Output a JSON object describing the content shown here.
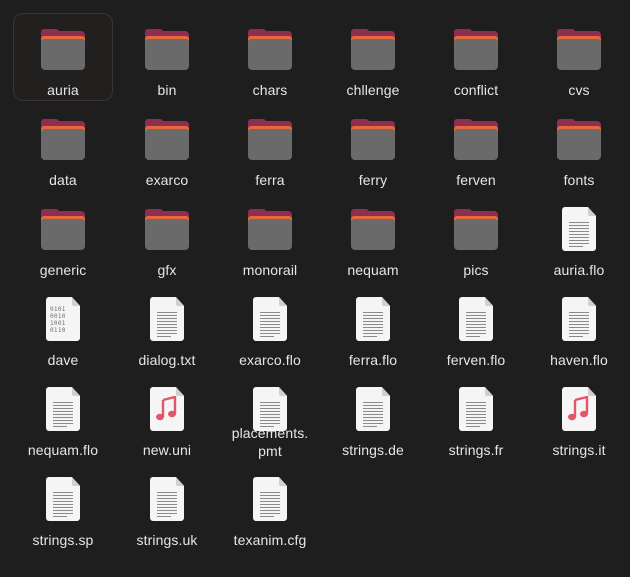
{
  "files": [
    {
      "name": "auria",
      "type": "folder",
      "selected": true
    },
    {
      "name": "bin",
      "type": "folder"
    },
    {
      "name": "chars",
      "type": "folder"
    },
    {
      "name": "chllenge",
      "type": "folder"
    },
    {
      "name": "conflict",
      "type": "folder"
    },
    {
      "name": "cvs",
      "type": "folder"
    },
    {
      "name": "data",
      "type": "folder"
    },
    {
      "name": "exarco",
      "type": "folder"
    },
    {
      "name": "ferra",
      "type": "folder"
    },
    {
      "name": "ferry",
      "type": "folder"
    },
    {
      "name": "ferven",
      "type": "folder"
    },
    {
      "name": "fonts",
      "type": "folder"
    },
    {
      "name": "generic",
      "type": "folder"
    },
    {
      "name": "gfx",
      "type": "folder"
    },
    {
      "name": "monorail",
      "type": "folder"
    },
    {
      "name": "nequam",
      "type": "folder"
    },
    {
      "name": "pics",
      "type": "folder"
    },
    {
      "name": "auria.flo",
      "type": "text"
    },
    {
      "name": "dave",
      "type": "binary"
    },
    {
      "name": "dialog.txt",
      "type": "text"
    },
    {
      "name": "exarco.flo",
      "type": "text"
    },
    {
      "name": "ferra.flo",
      "type": "text"
    },
    {
      "name": "ferven.flo",
      "type": "text"
    },
    {
      "name": "haven.flo",
      "type": "text"
    },
    {
      "name": "nequam.flo",
      "type": "text"
    },
    {
      "name": "new.uni",
      "type": "audio"
    },
    {
      "name": "placements.pmt",
      "type": "text"
    },
    {
      "name": "strings.de",
      "type": "text"
    },
    {
      "name": "strings.fr",
      "type": "text"
    },
    {
      "name": "strings.it",
      "type": "audio"
    },
    {
      "name": "strings.sp",
      "type": "text"
    },
    {
      "name": "strings.uk",
      "type": "text"
    },
    {
      "name": "texanim.cfg",
      "type": "text"
    }
  ],
  "binary_glyph": "0101\n0010\n1001\n0110",
  "colors": {
    "background": "#1e1e1e",
    "folder_back": "#8e2f52",
    "folder_accent": "#e5693a",
    "folder_front": "#6a6a6a",
    "music_note": "#e0566a",
    "label": "#e6e6e6"
  }
}
